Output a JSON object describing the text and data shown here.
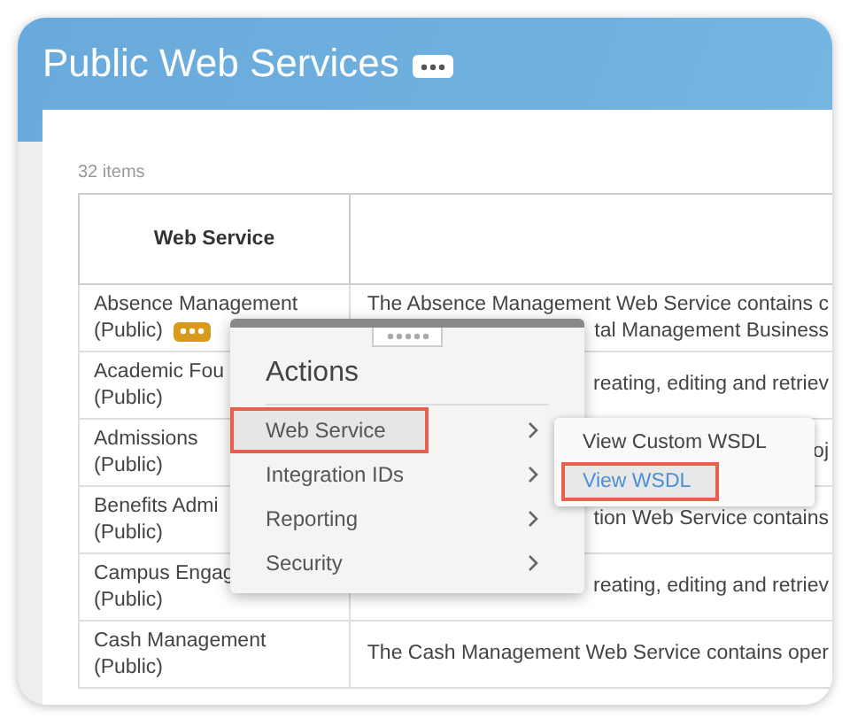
{
  "page": {
    "title": "Public Web Services",
    "item_count": "32 items"
  },
  "table": {
    "columns": [
      {
        "label": "Web Service"
      }
    ],
    "rows": [
      {
        "name": [
          "Absence Management",
          "(Public)"
        ],
        "has_actions": true,
        "description": [
          "The Absence Management Web Service contains c",
          "tal Management Business"
        ]
      },
      {
        "name": [
          "Academic Fou",
          "(Public)"
        ],
        "has_actions": false,
        "description": [
          "reating, editing and retriev"
        ]
      },
      {
        "name": [
          "Admissions",
          "(Public)"
        ],
        "has_actions": false,
        "description": [
          "oj"
        ]
      },
      {
        "name": [
          "Benefits Admi",
          "(Public)"
        ],
        "has_actions": false,
        "description": [
          "tion Web Service contains"
        ]
      },
      {
        "name": [
          "Campus Engag",
          "(Public)"
        ],
        "has_actions": false,
        "description": [
          "reating, editing and retriev"
        ]
      },
      {
        "name": [
          "Cash Management",
          "(Public)"
        ],
        "has_actions": false,
        "description": [
          "The Cash Management Web Service contains oper"
        ]
      }
    ]
  },
  "actions_menu": {
    "title": "Actions",
    "items": [
      {
        "label": "Web Service",
        "selected": true
      },
      {
        "label": "Integration IDs",
        "selected": false
      },
      {
        "label": "Reporting",
        "selected": false
      },
      {
        "label": "Security",
        "selected": false
      }
    ]
  },
  "submenu": {
    "items": [
      {
        "label": "View Custom WSDL",
        "selected": false
      },
      {
        "label": "View WSDL",
        "selected": true
      }
    ]
  }
}
